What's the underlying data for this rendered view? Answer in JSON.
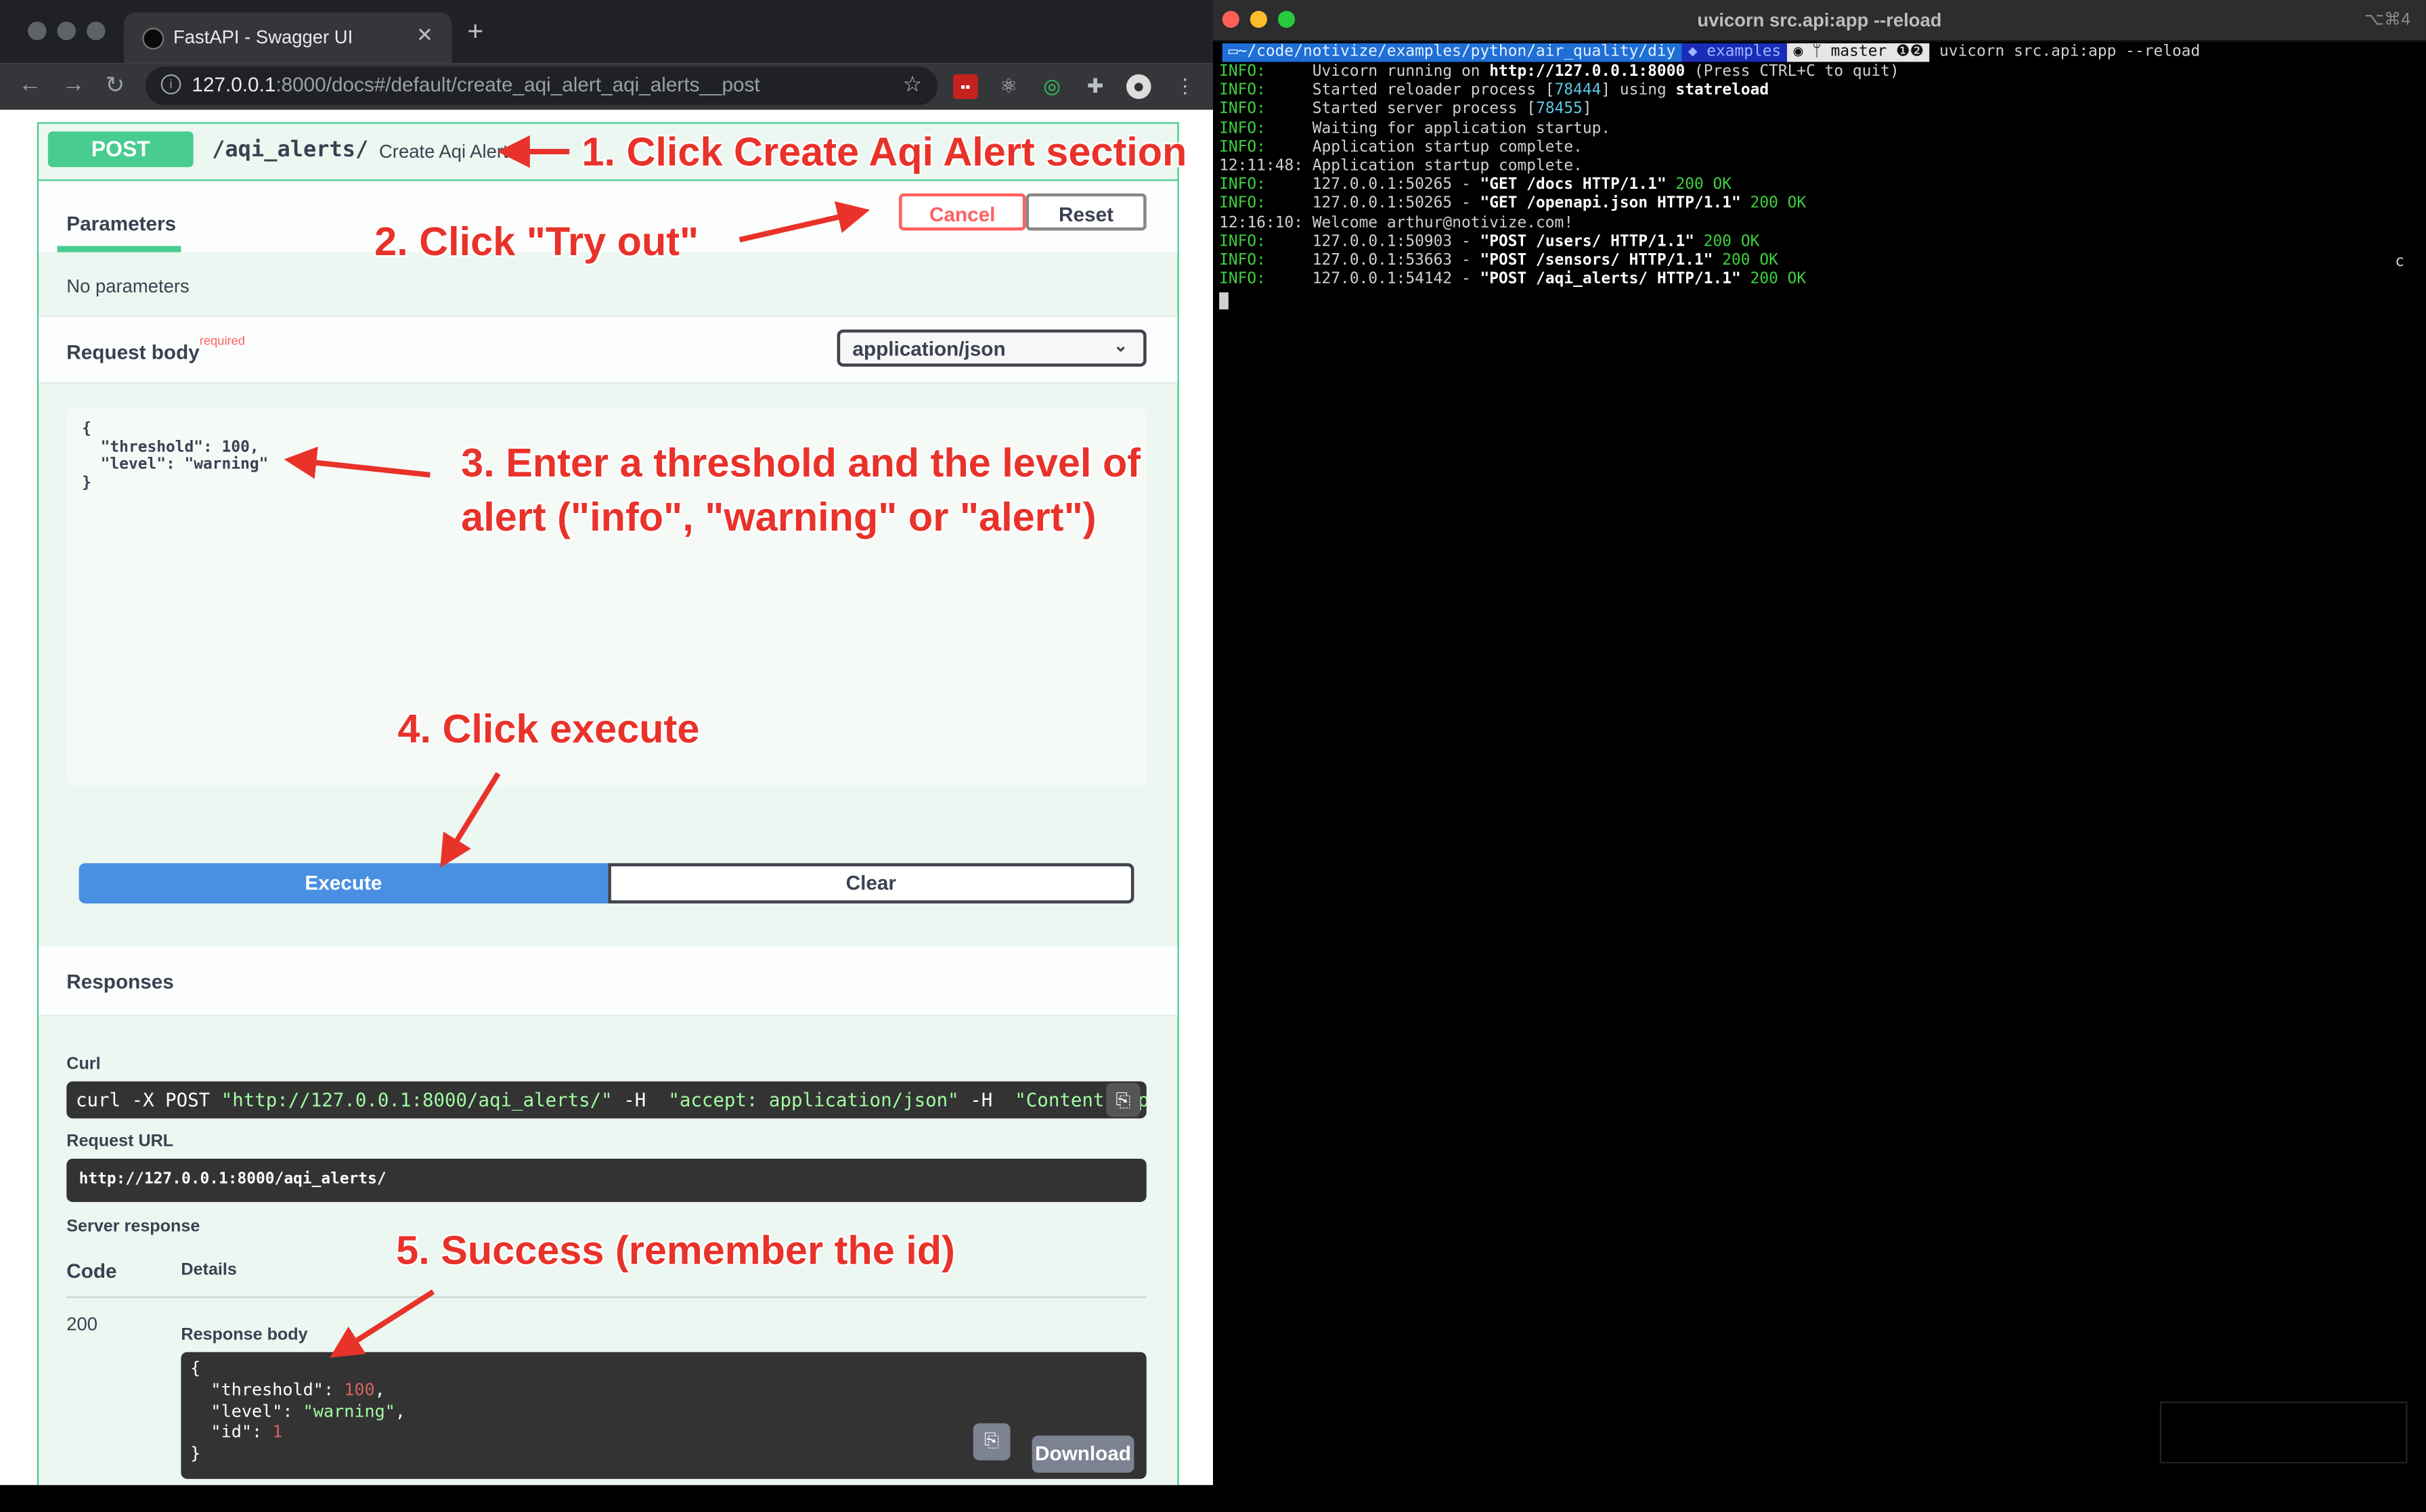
{
  "browser": {
    "tab_title": "FastAPI - Swagger UI",
    "url_host": "127.0.0.1",
    "url_rest": ":8000/docs#/default/create_aqi_alert_aqi_alerts__post"
  },
  "swagger": {
    "method": "POST",
    "path": "/aqi_alerts/",
    "summary": "Create Aqi Alert",
    "parameters_tab": "Parameters",
    "cancel_label": "Cancel",
    "reset_label": "Reset",
    "no_parameters": "No parameters",
    "request_body_label": "Request body",
    "required_label": "required",
    "content_type": "application/json",
    "request_body_text": "{\n  \"threshold\": 100,\n  \"level\": \"warning\"\n}",
    "execute_label": "Execute",
    "clear_label": "Clear",
    "responses_label": "Responses",
    "curl_label": "Curl",
    "curl_cmd": "curl -X POST",
    "curl_url": "\"http://127.0.0.1:8000/aqi_alerts/\"",
    "curl_flag1": "-H",
    "curl_accept": "\"accept: application/json\"",
    "curl_flag2": "-H",
    "curl_ctype": "\"Content-Type: application/json\"",
    "request_url_label": "Request URL",
    "request_url": "http://127.0.0.1:8000/aqi_alerts/",
    "server_response_label": "Server response",
    "code_header": "Code",
    "details_header": "Details",
    "response_code": "200",
    "response_body_label": "Response body",
    "response_json": {
      "threshold_key": "\"threshold\"",
      "threshold_val": "100",
      "level_key": "\"level\"",
      "level_val": "\"warning\"",
      "id_key": "\"id\"",
      "id_val": "1"
    },
    "download_label": "Download"
  },
  "annotations": {
    "step1": "1. Click Create Aqi Alert section",
    "step2": "2. Click \"Try out\"",
    "step3_line1": "3. Enter a threshold and the level of",
    "step3_line2": "alert (\"info\", \"warning\" or \"alert\")",
    "step4": "4. Click execute",
    "step5": "5. Success (remember the id)",
    "color": "#e8322a"
  },
  "terminal": {
    "title": "uvicorn src.api:app --reload",
    "shortcut": "⌥⌘4",
    "prompt_path": "~/code/notivize/examples/python/air_quality/diy",
    "prompt_env": "examples",
    "prompt_branch": "master",
    "prompt_command": "uvicorn src.api:app --reload",
    "stray_char": "c",
    "lines": [
      {
        "prefix": "INFO:     ",
        "text": "Uvicorn running on ",
        "bold": "http://127.0.0.1:8000",
        "rest": " (Press CTRL+C to quit)"
      },
      {
        "prefix": "INFO:     ",
        "text": "Started reloader process [",
        "cyan": "78444",
        "rest": "] using ",
        "bold2": "statreload"
      },
      {
        "prefix": "INFO:     ",
        "text": "Started server process [",
        "cyan": "78455",
        "rest": "]"
      },
      {
        "prefix": "INFO:     ",
        "text": "Waiting for application startup."
      },
      {
        "prefix": "INFO:     ",
        "text": "Application startup complete."
      },
      {
        "prefix": "12:11:48: ",
        "text": "Application startup complete."
      },
      {
        "prefix": "INFO:     ",
        "text": "127.0.0.1:50265 - ",
        "bold": "\"GET /docs HTTP/1.1\"",
        "green": " 200 OK"
      },
      {
        "prefix": "INFO:     ",
        "text": "127.0.0.1:50265 - ",
        "bold": "\"GET /openapi.json HTTP/1.1\"",
        "green": " 200 OK"
      },
      {
        "prefix": "12:16:10: ",
        "text": "Welcome arthur@notivize.com!"
      },
      {
        "prefix": "INFO:     ",
        "text": "127.0.0.1:50903 - ",
        "bold": "\"POST /users/ HTTP/1.1\"",
        "green": " 200 OK"
      },
      {
        "prefix": "INFO:     ",
        "text": "127.0.0.1:53663 - ",
        "bold": "\"POST /sensors/ HTTP/1.1\"",
        "green": " 200 OK"
      },
      {
        "prefix": "INFO:     ",
        "text": "127.0.0.1:54142 - ",
        "bold": "\"POST /aqi_alerts/ HTTP/1.1\"",
        "green": " 200 OK"
      }
    ]
  }
}
